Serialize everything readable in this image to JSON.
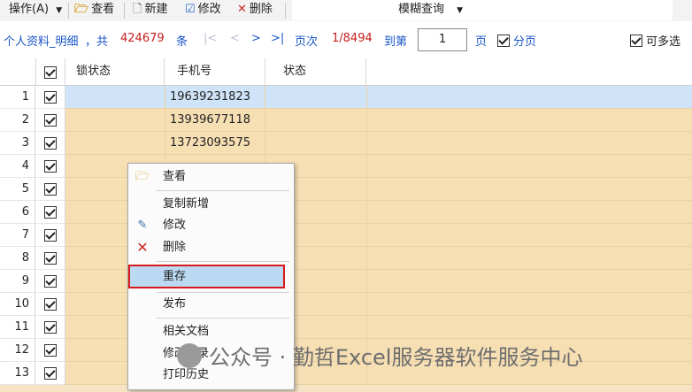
{
  "toolbar": {
    "ops_label": "操作(A)",
    "ops_icon": "dropdown-arrow",
    "view_label": "查看",
    "new_label": "新建",
    "edit_label": "修改",
    "delete_label": "删除",
    "search_mode_label": "模糊查询"
  },
  "infobar": {
    "title": "个人资料_明细",
    "total_prefix": "，共",
    "total_count": "424679",
    "total_unit": "条",
    "nav_first": "|<",
    "nav_prev": "<",
    "nav_next": ">",
    "nav_last": ">|",
    "page_label": "页次",
    "page_info": "1/8494",
    "goto_label": "到第",
    "goto_value": "1",
    "page_unit": "页",
    "paging_label": "分页",
    "multiselect_label": "可多选"
  },
  "grid": {
    "columns": [
      "锁状态",
      "手机号",
      "状态"
    ],
    "rows": [
      {
        "num": "1",
        "phone": "19639231823",
        "checked": true,
        "selected": true
      },
      {
        "num": "2",
        "phone": "13939677118",
        "checked": true
      },
      {
        "num": "3",
        "phone": "13723093575",
        "checked": true
      },
      {
        "num": "4",
        "phone": "",
        "checked": true
      },
      {
        "num": "5",
        "phone": "",
        "checked": true
      },
      {
        "num": "6",
        "phone": "",
        "checked": true
      },
      {
        "num": "7",
        "phone": "",
        "checked": true
      },
      {
        "num": "8",
        "phone": "",
        "checked": true
      },
      {
        "num": "9",
        "phone": "",
        "checked": true
      },
      {
        "num": "10",
        "phone": "",
        "checked": true
      },
      {
        "num": "11",
        "phone": "",
        "checked": true
      },
      {
        "num": "12",
        "phone": "",
        "checked": true
      },
      {
        "num": "13",
        "phone": "",
        "checked": true
      }
    ]
  },
  "context_menu": {
    "view": "查看",
    "copy_new": "复制新增",
    "edit": "修改",
    "delete": "删除",
    "resave": "重存",
    "publish": "发布",
    "related_docs": "相关文档",
    "edit_history": "修改记录",
    "print_history": "打印历史"
  },
  "watermark": {
    "text": "公众号 · 勤哲Excel服务器软件服务中心"
  },
  "colors": {
    "row_bg": "#f7dfb4",
    "selected_row_bg": "#cfe4f8",
    "highlight_border": "#d71a1a",
    "link_blue": "#1a55c7",
    "count_red": "#c81e1e"
  }
}
